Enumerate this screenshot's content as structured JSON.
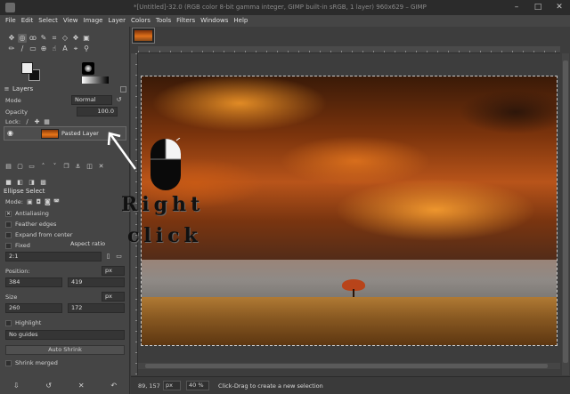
{
  "window": {
    "title": "*[Untitled]-32.0 (RGB color 8-bit gamma integer, GIMP built-in sRGB, 1 layer) 960x629 – GIMP",
    "controls": [
      "–",
      "□",
      "✕"
    ]
  },
  "menu": [
    "File",
    "Edit",
    "Select",
    "View",
    "Image",
    "Layer",
    "Colors",
    "Tools",
    "Filters",
    "Windows",
    "Help"
  ],
  "layers_panel": {
    "title": "Layers",
    "mode_label": "Mode",
    "mode_value": "Normal",
    "opacity_label": "Opacity",
    "opacity_value": "100.0",
    "lock_label": "Lock:",
    "layer_name": "Pasted Layer"
  },
  "tool_options": {
    "title": "Ellipse Select",
    "mode_label": "Mode:",
    "antialiasing": "Antialiasing",
    "feather": "Feather edges",
    "expand": "Expand from center",
    "fixed_label": "Fixed",
    "fixed_value": "Aspect ratio",
    "ratio_value": "2:1",
    "position_label": "Position:",
    "position_unit": "px",
    "position_x": "384",
    "position_y": "419",
    "size_label": "Size",
    "size_unit": "px",
    "size_w": "260",
    "size_h": "172",
    "highlight": "Highlight",
    "guides_value": "No guides",
    "auto_shrink": "Auto Shrink",
    "shrink_merged": "Shrink merged"
  },
  "annotation": {
    "line1": "Right",
    "line2": "click"
  },
  "status": {
    "coords": "89, 157",
    "unit": "px",
    "zoom": "40 %",
    "message": "Click-Drag to create a new selection"
  }
}
